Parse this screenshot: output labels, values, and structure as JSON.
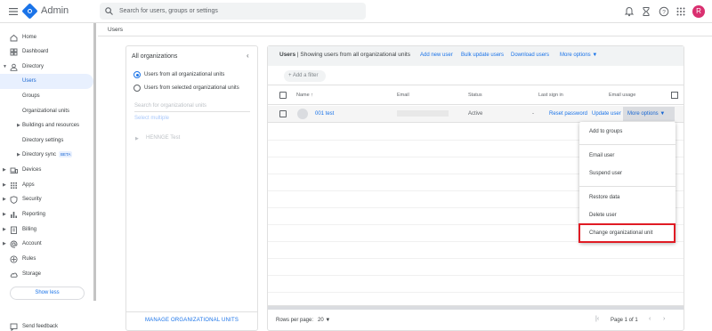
{
  "header": {
    "app_name": "Admin",
    "search_placeholder": "Search for users, groups or settings",
    "avatar_letter": "R",
    "avatar_color": "#d93070"
  },
  "sidebar": {
    "items": [
      {
        "label": "Home",
        "icon": "home-icon"
      },
      {
        "label": "Dashboard",
        "icon": "dashboard-icon"
      },
      {
        "label": "Directory",
        "icon": "person-icon"
      },
      {
        "label": "Users",
        "selected": true
      },
      {
        "label": "Groups"
      },
      {
        "label": "Organizational units"
      },
      {
        "label": "Buildings and resources"
      },
      {
        "label": "Directory settings"
      },
      {
        "label": "Directory sync",
        "badge": "BETA"
      },
      {
        "label": "Devices",
        "icon": "devices-icon"
      },
      {
        "label": "Apps",
        "icon": "apps-grid-icon"
      },
      {
        "label": "Security",
        "icon": "shield-icon"
      },
      {
        "label": "Reporting",
        "icon": "bar-chart-icon"
      },
      {
        "label": "Billing",
        "icon": "billing-icon"
      },
      {
        "label": "Account",
        "icon": "at-icon"
      },
      {
        "label": "Rules",
        "icon": "rules-icon"
      },
      {
        "label": "Storage",
        "icon": "cloud-icon"
      }
    ],
    "show_less": "Show less",
    "send_feedback": "Send feedback"
  },
  "breadcrumb": "Users",
  "org_panel": {
    "title": "All organizations",
    "radio_all": "Users from all organizational units",
    "radio_selected": "Users from selected organizational units",
    "search_placeholder": "Search for organizational units",
    "select_multiple": "Select multiple",
    "tree_item": "HENNGE Test",
    "manage_button": "MANAGE ORGANIZATIONAL UNITS"
  },
  "users_panel": {
    "title_bold": "Users",
    "title_rest": " | Showing users from all organizational units",
    "actions": [
      "Add new user",
      "Bulk update users",
      "Download users",
      "More options"
    ],
    "add_filter": "+ Add a filter",
    "columns": [
      "Name",
      "Email",
      "Status",
      "Last sign in",
      "Email usage"
    ],
    "row": {
      "name": "001 test",
      "status": "Active",
      "last_sign_in": "-",
      "reset_password": "Reset password",
      "update_user": "Update user",
      "more_options": "More options"
    },
    "rows_per_page_label": "Rows per page:",
    "rows_per_page_value": "20",
    "pager_text": "Page 1 of 1"
  },
  "more_menu": {
    "items": [
      "Add to groups",
      "Email user",
      "Suspend user",
      "Restore data",
      "Delete user",
      "Change organizational unit"
    ],
    "highlighted": "Change organizational unit",
    "highlight_color": "#e01b24"
  },
  "colors": {
    "accent": "#1a73e8",
    "selected_bg": "#e8f0fe"
  }
}
